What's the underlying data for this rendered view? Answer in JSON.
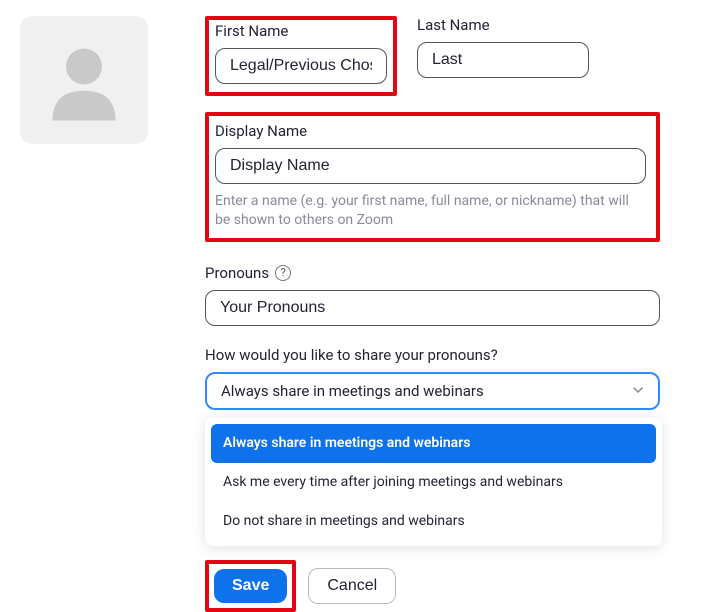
{
  "firstName": {
    "label": "First Name",
    "value": "Legal/Previous Chosen"
  },
  "lastName": {
    "label": "Last Name",
    "value": "Last"
  },
  "displayName": {
    "label": "Display Name",
    "value": "Display Name",
    "hint": "Enter a name (e.g. your first name, full name, or nickname) that will be shown to others on Zoom"
  },
  "pronouns": {
    "label": "Pronouns",
    "placeholder": "Your Pronouns",
    "value": "Your Pronouns"
  },
  "share": {
    "label": "How would you like to share your pronouns?",
    "selected": "Always share in meetings and webinars",
    "options": [
      "Always share in meetings and webinars",
      "Ask me every time after joining meetings and webinars",
      "Do not share in meetings and webinars"
    ]
  },
  "buttons": {
    "save": "Save",
    "cancel": "Cancel"
  }
}
